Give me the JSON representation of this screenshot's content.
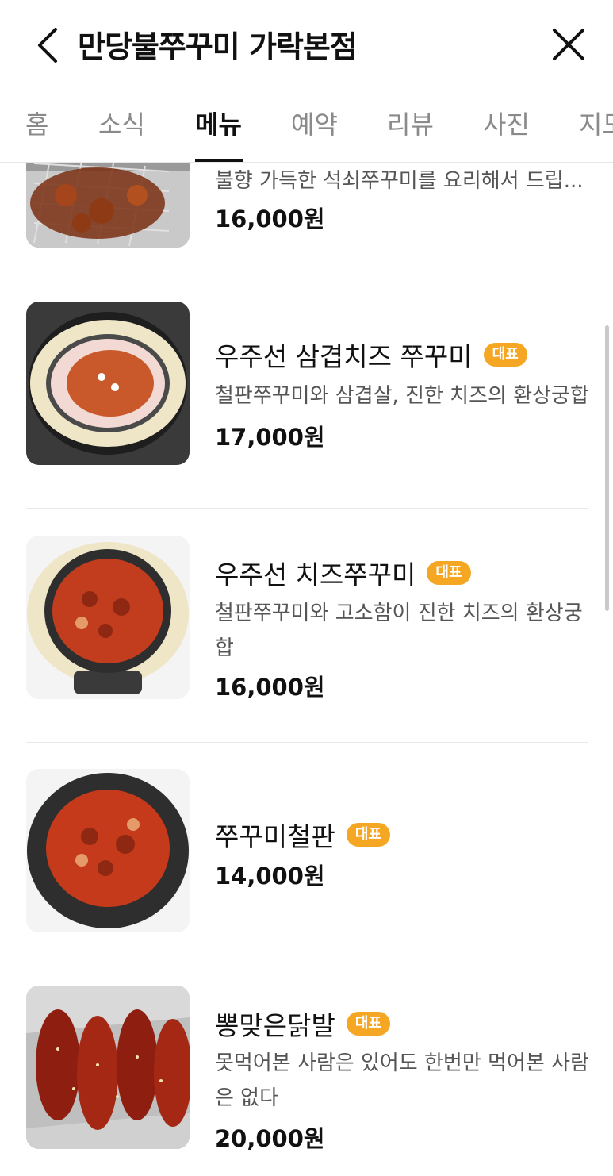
{
  "header": {
    "title": "만당불쭈꾸미 가락본점",
    "back_icon": "chevron-left-icon",
    "close_icon": "close-icon"
  },
  "tabs": [
    {
      "label": "홈",
      "active": false
    },
    {
      "label": "소식",
      "active": false
    },
    {
      "label": "메뉴",
      "active": true
    },
    {
      "label": "예약",
      "active": false
    },
    {
      "label": "리뷰",
      "active": false
    },
    {
      "label": "사진",
      "active": false
    },
    {
      "label": "지도",
      "active": false
    }
  ],
  "menu": {
    "items": [
      {
        "name": "",
        "badge": "",
        "description": "불향 가득한 석쇠쭈꾸미를 요리해서 드립...",
        "price": "16,000원"
      },
      {
        "name": "우주선 삼겹치즈 쭈꾸미",
        "badge": "대표",
        "description": "철판쭈꾸미와 삼겹살, 진한 치즈의 환상궁합",
        "price": "17,000원"
      },
      {
        "name": "우주선 치즈쭈꾸미",
        "badge": "대표",
        "description": "철판쭈꾸미와 고소함이 진한 치즈의 환상궁합",
        "price": "16,000원"
      },
      {
        "name": "쭈꾸미철판",
        "badge": "대표",
        "description": "",
        "price": "14,000원"
      },
      {
        "name": "뽕맞은닭발",
        "badge": "대표",
        "description": "못먹어본 사람은 있어도 한번만 먹어본 사람은 없다",
        "price": "20,000원"
      }
    ]
  },
  "colors": {
    "badge": "#f5a623",
    "active_tab": "#111111",
    "inactive_tab": "#8a8a8a"
  }
}
